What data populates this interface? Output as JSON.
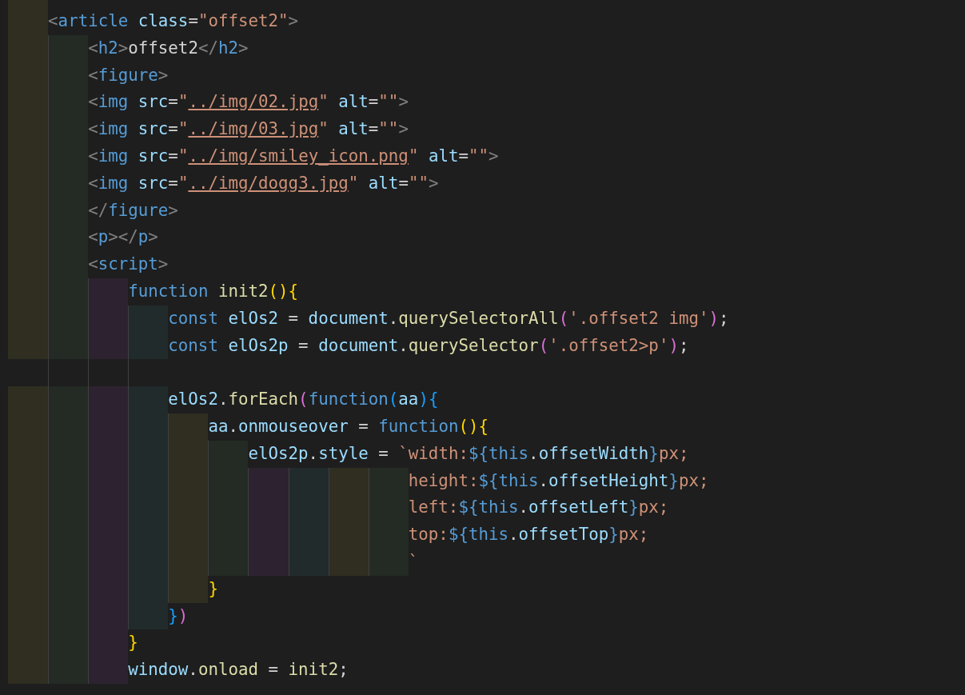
{
  "editor": {
    "lines": [
      {
        "indent": [
          {
            "kind": "fill"
          }
        ],
        "tokens": [
          {
            "text": "<",
            "kind": "punct"
          },
          {
            "text": "article",
            "kind": "tag"
          },
          {
            "text": " class",
            "kind": "attr"
          },
          {
            "text": "=",
            "kind": "text"
          },
          {
            "text": "\"offset2\"",
            "kind": "str"
          },
          {
            "text": ">",
            "kind": "punct"
          }
        ]
      },
      {
        "indent": [
          {
            "kind": "fill"
          },
          {
            "kind": "fill"
          }
        ],
        "tokens": [
          {
            "text": "<",
            "kind": "punct"
          },
          {
            "text": "h2",
            "kind": "tag"
          },
          {
            "text": ">",
            "kind": "punct"
          },
          {
            "text": "offset2",
            "kind": "text"
          },
          {
            "text": "</",
            "kind": "punct"
          },
          {
            "text": "h2",
            "kind": "tag"
          },
          {
            "text": ">",
            "kind": "punct"
          }
        ]
      },
      {
        "indent": [
          {
            "kind": "fill"
          },
          {
            "kind": "fill"
          }
        ],
        "tokens": [
          {
            "text": "<",
            "kind": "punct"
          },
          {
            "text": "figure",
            "kind": "tag"
          },
          {
            "text": ">",
            "kind": "punct"
          }
        ]
      },
      {
        "indent": [
          {
            "kind": "fill"
          },
          {
            "kind": "fill"
          }
        ],
        "tokens": [
          {
            "text": "<",
            "kind": "punct"
          },
          {
            "text": "img",
            "kind": "tag"
          },
          {
            "text": " src",
            "kind": "attr"
          },
          {
            "text": "=",
            "kind": "text"
          },
          {
            "text": "\"",
            "kind": "str"
          },
          {
            "text": "../img/02.jpg",
            "kind": "link"
          },
          {
            "text": "\"",
            "kind": "str"
          },
          {
            "text": " alt",
            "kind": "attr"
          },
          {
            "text": "=",
            "kind": "text"
          },
          {
            "text": "\"\"",
            "kind": "str"
          },
          {
            "text": ">",
            "kind": "punct"
          }
        ]
      },
      {
        "indent": [
          {
            "kind": "fill"
          },
          {
            "kind": "fill"
          }
        ],
        "tokens": [
          {
            "text": "<",
            "kind": "punct"
          },
          {
            "text": "img",
            "kind": "tag"
          },
          {
            "text": " src",
            "kind": "attr"
          },
          {
            "text": "=",
            "kind": "text"
          },
          {
            "text": "\"",
            "kind": "str"
          },
          {
            "text": "../img/03.jpg",
            "kind": "link"
          },
          {
            "text": "\"",
            "kind": "str"
          },
          {
            "text": " alt",
            "kind": "attr"
          },
          {
            "text": "=",
            "kind": "text"
          },
          {
            "text": "\"\"",
            "kind": "str"
          },
          {
            "text": ">",
            "kind": "punct"
          }
        ]
      },
      {
        "indent": [
          {
            "kind": "fill"
          },
          {
            "kind": "fill"
          }
        ],
        "tokens": [
          {
            "text": "<",
            "kind": "punct"
          },
          {
            "text": "img",
            "kind": "tag"
          },
          {
            "text": " src",
            "kind": "attr"
          },
          {
            "text": "=",
            "kind": "text"
          },
          {
            "text": "\"",
            "kind": "str"
          },
          {
            "text": "../img/smiley_icon.png",
            "kind": "link"
          },
          {
            "text": "\"",
            "kind": "str"
          },
          {
            "text": " alt",
            "kind": "attr"
          },
          {
            "text": "=",
            "kind": "text"
          },
          {
            "text": "\"\"",
            "kind": "str"
          },
          {
            "text": ">",
            "kind": "punct"
          }
        ]
      },
      {
        "indent": [
          {
            "kind": "fill"
          },
          {
            "kind": "fill"
          }
        ],
        "tokens": [
          {
            "text": "<",
            "kind": "punct"
          },
          {
            "text": "img",
            "kind": "tag"
          },
          {
            "text": " src",
            "kind": "attr"
          },
          {
            "text": "=",
            "kind": "text"
          },
          {
            "text": "\"",
            "kind": "str"
          },
          {
            "text": "../img/dogg3.jpg",
            "kind": "link"
          },
          {
            "text": "\"",
            "kind": "str"
          },
          {
            "text": " alt",
            "kind": "attr"
          },
          {
            "text": "=",
            "kind": "text"
          },
          {
            "text": "\"\"",
            "kind": "str"
          },
          {
            "text": ">",
            "kind": "punct"
          }
        ]
      },
      {
        "indent": [
          {
            "kind": "fill"
          },
          {
            "kind": "fill"
          }
        ],
        "tokens": [
          {
            "text": "</",
            "kind": "punct"
          },
          {
            "text": "figure",
            "kind": "tag"
          },
          {
            "text": ">",
            "kind": "punct"
          }
        ]
      },
      {
        "indent": [
          {
            "kind": "fill"
          },
          {
            "kind": "fill"
          }
        ],
        "tokens": [
          {
            "text": "<",
            "kind": "punct"
          },
          {
            "text": "p",
            "kind": "tag"
          },
          {
            "text": "></",
            "kind": "punct"
          },
          {
            "text": "p",
            "kind": "tag"
          },
          {
            "text": ">",
            "kind": "punct"
          }
        ]
      },
      {
        "indent": [
          {
            "kind": "fill"
          },
          {
            "kind": "fill"
          }
        ],
        "tokens": [
          {
            "text": "<",
            "kind": "punct"
          },
          {
            "text": "script",
            "kind": "tag"
          },
          {
            "text": ">",
            "kind": "punct"
          }
        ]
      },
      {
        "indent": [
          {
            "kind": "fill"
          },
          {
            "kind": "fill"
          },
          {
            "kind": "fill"
          }
        ],
        "tokens": [
          {
            "text": "function",
            "kind": "kw"
          },
          {
            "text": " init2",
            "kind": "fn"
          },
          {
            "text": "(){",
            "kind": "b1"
          }
        ]
      },
      {
        "indent": [
          {
            "kind": "fill"
          },
          {
            "kind": "fill"
          },
          {
            "kind": "fill"
          },
          {
            "kind": "fill"
          }
        ],
        "tokens": [
          {
            "text": "const",
            "kind": "kw"
          },
          {
            "text": " elOs2",
            "kind": "var"
          },
          {
            "text": " = ",
            "kind": "text"
          },
          {
            "text": "document",
            "kind": "var"
          },
          {
            "text": ".",
            "kind": "text"
          },
          {
            "text": "querySelectorAll",
            "kind": "fn"
          },
          {
            "text": "(",
            "kind": "b2"
          },
          {
            "text": "'.offset2 img'",
            "kind": "str"
          },
          {
            "text": ")",
            "kind": "b2"
          },
          {
            "text": ";",
            "kind": "text"
          }
        ]
      },
      {
        "indent": [
          {
            "kind": "fill"
          },
          {
            "kind": "fill"
          },
          {
            "kind": "fill"
          },
          {
            "kind": "fill"
          }
        ],
        "tokens": [
          {
            "text": "const",
            "kind": "kw"
          },
          {
            "text": " elOs2p",
            "kind": "var"
          },
          {
            "text": " = ",
            "kind": "text"
          },
          {
            "text": "document",
            "kind": "var"
          },
          {
            "text": ".",
            "kind": "text"
          },
          {
            "text": "querySelector",
            "kind": "fn"
          },
          {
            "text": "(",
            "kind": "b2"
          },
          {
            "text": "'.offset2>p'",
            "kind": "str"
          },
          {
            "text": ")",
            "kind": "b2"
          },
          {
            "text": ";",
            "kind": "text"
          }
        ]
      },
      {
        "indent": [
          {
            "kind": "empty"
          },
          {
            "kind": "guide"
          },
          {
            "kind": "guide"
          },
          {
            "kind": "guide"
          }
        ]
      },
      {
        "indent": [
          {
            "kind": "fill"
          },
          {
            "kind": "fill"
          },
          {
            "kind": "fill"
          },
          {
            "kind": "fill"
          }
        ],
        "tokens": [
          {
            "text": "elOs2",
            "kind": "var"
          },
          {
            "text": ".",
            "kind": "text"
          },
          {
            "text": "forEach",
            "kind": "fn"
          },
          {
            "text": "(",
            "kind": "b2"
          },
          {
            "text": "function",
            "kind": "kw"
          },
          {
            "text": "(",
            "kind": "b3"
          },
          {
            "text": "aa",
            "kind": "var"
          },
          {
            "text": "){",
            "kind": "b3"
          }
        ]
      },
      {
        "indent": [
          {
            "kind": "fill"
          },
          {
            "kind": "fill"
          },
          {
            "kind": "fill"
          },
          {
            "kind": "fill"
          },
          {
            "kind": "fill"
          }
        ],
        "tokens": [
          {
            "text": "aa",
            "kind": "var"
          },
          {
            "text": ".",
            "kind": "text"
          },
          {
            "text": "onmouseover",
            "kind": "var"
          },
          {
            "text": " = ",
            "kind": "text"
          },
          {
            "text": "function",
            "kind": "kw"
          },
          {
            "text": "(){",
            "kind": "b1"
          }
        ]
      },
      {
        "indent": [
          {
            "kind": "fill"
          },
          {
            "kind": "fill"
          },
          {
            "kind": "fill"
          },
          {
            "kind": "fill"
          },
          {
            "kind": "fill"
          },
          {
            "kind": "fill"
          }
        ],
        "tokens": [
          {
            "text": "elOs2p",
            "kind": "var"
          },
          {
            "text": ".",
            "kind": "text"
          },
          {
            "text": "style",
            "kind": "var"
          },
          {
            "text": " = ",
            "kind": "text"
          },
          {
            "text": "`width:",
            "kind": "str"
          },
          {
            "text": "${",
            "kind": "tpl"
          },
          {
            "text": "this",
            "kind": "tpl"
          },
          {
            "text": ".",
            "kind": "text"
          },
          {
            "text": "offsetWidth",
            "kind": "var"
          },
          {
            "text": "}",
            "kind": "tpl"
          },
          {
            "text": "px;",
            "kind": "str"
          }
        ]
      },
      {
        "indent": [
          {
            "kind": "fill"
          },
          {
            "kind": "fill"
          },
          {
            "kind": "fill"
          },
          {
            "kind": "fill"
          },
          {
            "kind": "fill"
          },
          {
            "kind": "fill"
          },
          {
            "kind": "fill"
          },
          {
            "kind": "fill"
          },
          {
            "kind": "fill"
          },
          {
            "kind": "fill"
          }
        ],
        "tokens": [
          {
            "text": "height:",
            "kind": "str"
          },
          {
            "text": "${",
            "kind": "tpl"
          },
          {
            "text": "this",
            "kind": "tpl"
          },
          {
            "text": ".",
            "kind": "text"
          },
          {
            "text": "offsetHeight",
            "kind": "var"
          },
          {
            "text": "}",
            "kind": "tpl"
          },
          {
            "text": "px;",
            "kind": "str"
          }
        ]
      },
      {
        "indent": [
          {
            "kind": "fill"
          },
          {
            "kind": "fill"
          },
          {
            "kind": "fill"
          },
          {
            "kind": "fill"
          },
          {
            "kind": "fill"
          },
          {
            "kind": "fill"
          },
          {
            "kind": "fill"
          },
          {
            "kind": "fill"
          },
          {
            "kind": "fill"
          },
          {
            "kind": "fill"
          }
        ],
        "tokens": [
          {
            "text": "left:",
            "kind": "str"
          },
          {
            "text": "${",
            "kind": "tpl"
          },
          {
            "text": "this",
            "kind": "tpl"
          },
          {
            "text": ".",
            "kind": "text"
          },
          {
            "text": "offsetLeft",
            "kind": "var"
          },
          {
            "text": "}",
            "kind": "tpl"
          },
          {
            "text": "px;",
            "kind": "str"
          }
        ]
      },
      {
        "indent": [
          {
            "kind": "fill"
          },
          {
            "kind": "fill"
          },
          {
            "kind": "fill"
          },
          {
            "kind": "fill"
          },
          {
            "kind": "fill"
          },
          {
            "kind": "fill"
          },
          {
            "kind": "fill"
          },
          {
            "kind": "fill"
          },
          {
            "kind": "fill"
          },
          {
            "kind": "fill"
          }
        ],
        "tokens": [
          {
            "text": "top:",
            "kind": "str"
          },
          {
            "text": "${",
            "kind": "tpl"
          },
          {
            "text": "this",
            "kind": "tpl"
          },
          {
            "text": ".",
            "kind": "text"
          },
          {
            "text": "offsetTop",
            "kind": "var"
          },
          {
            "text": "}",
            "kind": "tpl"
          },
          {
            "text": "px;",
            "kind": "str"
          }
        ]
      },
      {
        "indent": [
          {
            "kind": "fill"
          },
          {
            "kind": "fill"
          },
          {
            "kind": "fill"
          },
          {
            "kind": "fill"
          },
          {
            "kind": "fill"
          },
          {
            "kind": "fill"
          },
          {
            "kind": "fill"
          },
          {
            "kind": "fill"
          },
          {
            "kind": "fill"
          },
          {
            "kind": "fill"
          }
        ],
        "tokens": [
          {
            "text": "`",
            "kind": "str"
          }
        ]
      },
      {
        "indent": [
          {
            "kind": "fill"
          },
          {
            "kind": "fill"
          },
          {
            "kind": "fill"
          },
          {
            "kind": "fill"
          },
          {
            "kind": "fill"
          }
        ],
        "tokens": [
          {
            "text": "}",
            "kind": "b1"
          }
        ]
      },
      {
        "indent": [
          {
            "kind": "fill"
          },
          {
            "kind": "fill"
          },
          {
            "kind": "fill"
          },
          {
            "kind": "fill"
          }
        ],
        "tokens": [
          {
            "text": "}",
            "kind": "b3"
          },
          {
            "text": ")",
            "kind": "b2"
          }
        ]
      },
      {
        "indent": [
          {
            "kind": "fill"
          },
          {
            "kind": "fill"
          },
          {
            "kind": "fill"
          }
        ],
        "tokens": [
          {
            "text": "}",
            "kind": "b1"
          }
        ]
      },
      {
        "indent": [
          {
            "kind": "fill"
          },
          {
            "kind": "fill"
          },
          {
            "kind": "fill"
          }
        ],
        "tokens": [
          {
            "text": "window",
            "kind": "var"
          },
          {
            "text": ".",
            "kind": "text"
          },
          {
            "text": "onload",
            "kind": "fn"
          },
          {
            "text": " = ",
            "kind": "text"
          },
          {
            "text": "init2",
            "kind": "fn"
          },
          {
            "text": ";",
            "kind": "text"
          }
        ]
      }
    ]
  }
}
